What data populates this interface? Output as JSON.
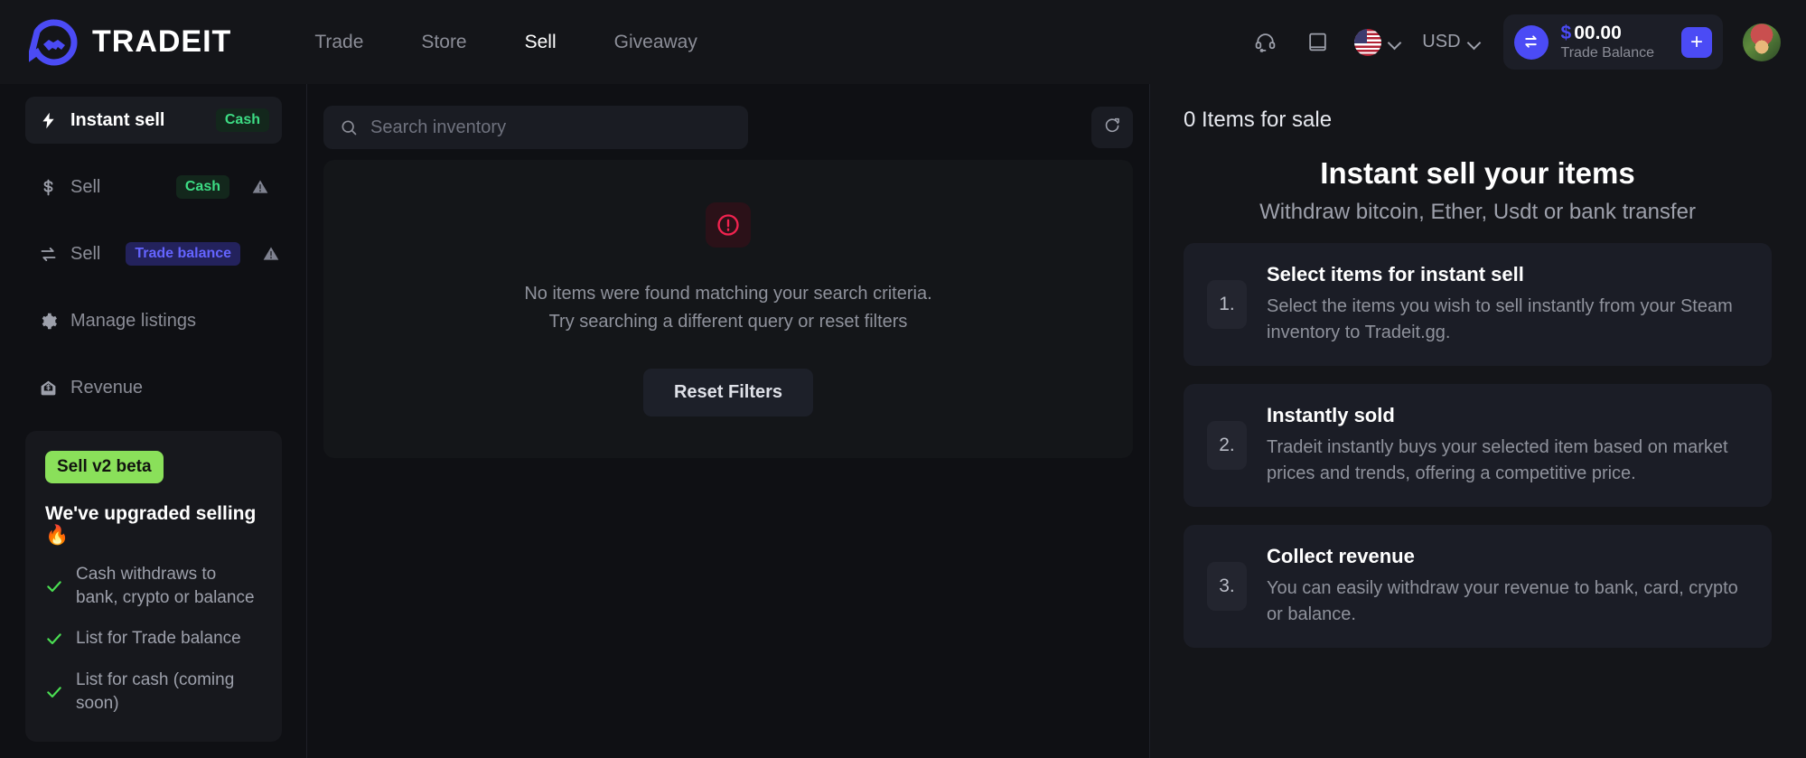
{
  "header": {
    "logo_text": "TRADEIT",
    "nav": [
      {
        "label": "Trade",
        "active": false
      },
      {
        "label": "Store",
        "active": false
      },
      {
        "label": "Sell",
        "active": true
      },
      {
        "label": "Giveaway",
        "active": false
      }
    ],
    "support_icon": "headset-icon",
    "docs_icon": "book-icon",
    "language": {
      "flag": "us-flag-icon",
      "chevron": "chevron-down-icon"
    },
    "currency": {
      "value": "USD",
      "chevron": "chevron-down-icon"
    },
    "balance": {
      "currency_symbol": "$",
      "amount": "00.00",
      "label": "Trade Balance",
      "swap_icon": "swap-arrows-icon",
      "add_label": "+"
    },
    "avatar": "user-avatar"
  },
  "sidebar": {
    "items": [
      {
        "label": "Instant sell",
        "icon": "lightning-bolt-icon",
        "tag": "Cash",
        "tag_type": "cash",
        "warning": false,
        "active": true
      },
      {
        "label": "Sell",
        "icon": "dollar-icon",
        "tag": "Cash",
        "tag_type": "cash",
        "warning": true,
        "active": false
      },
      {
        "label": "Sell",
        "icon": "swap-arrows-icon",
        "tag": "Trade balance",
        "tag_type": "trade",
        "warning": true,
        "active": false
      },
      {
        "label": "Manage listings",
        "icon": "gear-icon",
        "tag": null,
        "tag_type": null,
        "warning": false,
        "active": false
      },
      {
        "label": "Revenue",
        "icon": "money-envelope-icon",
        "tag": null,
        "tag_type": null,
        "warning": false,
        "active": false
      }
    ],
    "promo": {
      "badge": "Sell v2 beta",
      "title": "We've upgraded selling 🔥",
      "features": [
        "Cash withdraws to bank, crypto or balance",
        "List for Trade balance",
        "List for cash (coming soon)"
      ]
    }
  },
  "main": {
    "search": {
      "placeholder": "Search inventory",
      "value": "",
      "icon": "search-icon"
    },
    "refresh_icon": "refresh-icon",
    "empty_state": {
      "icon": "alert-circle-icon",
      "line1": "No items were found matching your search criteria.",
      "line2": "Try searching a different query or reset filters",
      "reset_label": "Reset Filters"
    }
  },
  "right_panel": {
    "items_for_sale": "0 Items for sale",
    "title": "Instant sell your items",
    "subtitle": "Withdraw bitcoin, Ether, Usdt or bank transfer",
    "steps": [
      {
        "num": "1.",
        "title": "Select items for instant sell",
        "desc": "Select the items you wish to sell instantly from your Steam inventory to Tradeit.gg."
      },
      {
        "num": "2.",
        "title": "Instantly sold",
        "desc": "Tradeit instantly buys your selected item based on market prices and trends, offering a competitive price."
      },
      {
        "num": "3.",
        "title": "Collect revenue",
        "desc": "You can easily withdraw your revenue to bank, card, crypto or balance."
      }
    ]
  },
  "colors": {
    "accent": "#4b4bf5",
    "cash_green": "#3ddc84",
    "beta_green": "#8ae05a",
    "error_red": "#f1234f",
    "page_bg": "#0f1014",
    "panel_bg": "#141519"
  }
}
